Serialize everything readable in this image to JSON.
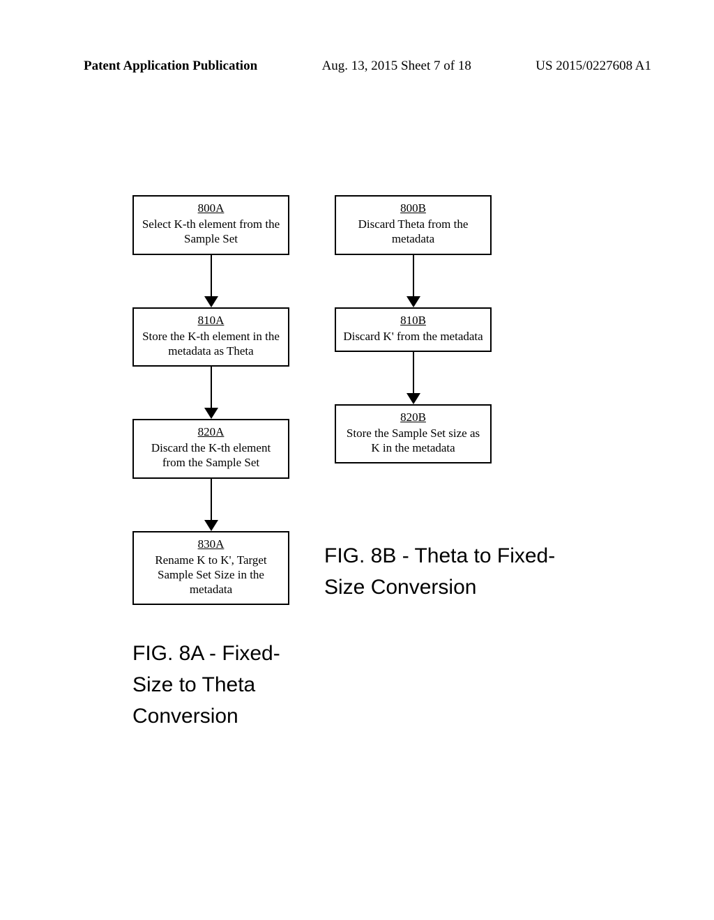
{
  "header": {
    "left": "Patent Application Publication",
    "center": "Aug. 13, 2015  Sheet 7 of 18",
    "right": "US 2015/0227608 A1"
  },
  "flowchartA": {
    "boxes": [
      {
        "id": "800A",
        "text": "Select K-th element from the Sample Set"
      },
      {
        "id": "810A",
        "text": "Store the K-th element in the metadata as Theta"
      },
      {
        "id": "820A",
        "text": "Discard the K-th element from the Sample Set"
      },
      {
        "id": "830A",
        "text": "Rename K to K', Target Sample Set Size in the metadata"
      }
    ],
    "label": "FIG. 8A - Fixed-Size to Theta Conversion"
  },
  "flowchartB": {
    "boxes": [
      {
        "id": "800B",
        "text": "Discard Theta from the metadata"
      },
      {
        "id": "810B",
        "text": "Discard K' from the metadata"
      },
      {
        "id": "820B",
        "text": "Store the Sample Set size as K in the metadata"
      }
    ],
    "label": "FIG. 8B - Theta to Fixed-Size Conversion"
  }
}
